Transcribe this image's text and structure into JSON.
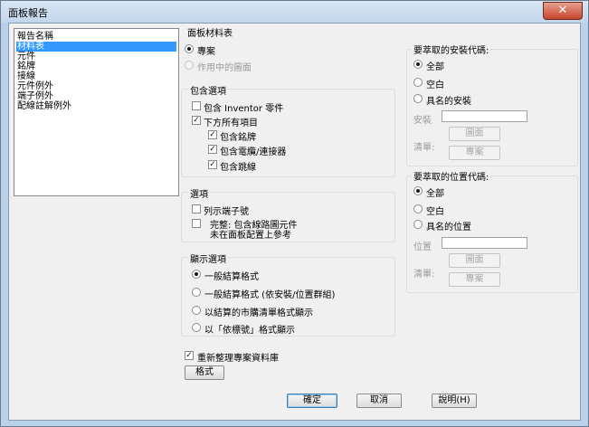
{
  "window": {
    "title": "面板報告",
    "close_label": "✕"
  },
  "report_list": {
    "items": [
      {
        "label": "報告名稱",
        "selected": false
      },
      {
        "label": "材料表",
        "selected": true
      },
      {
        "label": "元件",
        "selected": false
      },
      {
        "label": "銘牌",
        "selected": false
      },
      {
        "label": "接線",
        "selected": false
      },
      {
        "label": "元件例外",
        "selected": false
      },
      {
        "label": "端子例外",
        "selected": false
      },
      {
        "label": "配線註解例外",
        "selected": false
      }
    ]
  },
  "bom": {
    "section_label": "面板材料表",
    "project_label": "專案",
    "active_drawing_label": "作用中的圖面"
  },
  "include_options": {
    "title": "包含選項",
    "inventor_label": "包含 Inventor 零件",
    "all_items_label": "下方所有項目",
    "nameplate_label": "包含銘牌",
    "connector_label": "包含電纜/連接器",
    "jumper_label": "包含跳線"
  },
  "options": {
    "title": "選項",
    "terminal_numbers_label": "列示端子號",
    "complete_line1": "完整: 包含線路圖元件",
    "complete_line2": "未在面板配置上參考"
  },
  "display_options": {
    "title": "顯示選項",
    "general_label": "一般結算格式",
    "general_grouped_label": "一般結算格式 (依安裝/位置群組)",
    "purchase_label": "以結算的市購清單格式顯示",
    "tag_label": "以「依標號」格式顯示"
  },
  "install_codes": {
    "title": "要萃取的安裝代碼:",
    "all_label": "全部",
    "blank_label": "空白",
    "named_label": "具名的安裝",
    "field_label": "安裝",
    "drawing_button": "圖面",
    "list_label": "清單:",
    "project_button": "專案"
  },
  "location_codes": {
    "title": "要萃取的位置代碼:",
    "all_label": "全部",
    "blank_label": "空白",
    "named_label": "具名的位置",
    "field_label": "位置",
    "drawing_button": "圖面",
    "list_label": "清單:",
    "project_button": "專案"
  },
  "bottom": {
    "refresh_label": "重新整理專案資料庫",
    "format_button": "格式",
    "ok_button": "確定",
    "cancel_button": "取消",
    "help_button": "說明(H)"
  }
}
